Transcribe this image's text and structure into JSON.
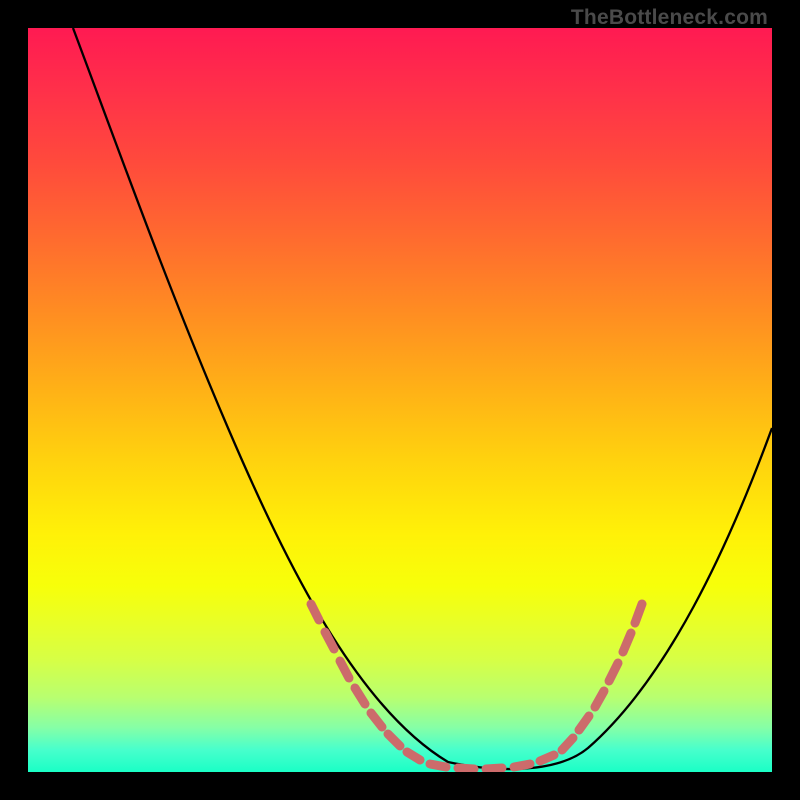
{
  "watermark": {
    "text": "TheBottleneck.com"
  },
  "chart_data": {
    "type": "line",
    "title": "",
    "xlabel": "",
    "ylabel": "",
    "xlim": [
      0,
      100
    ],
    "ylim": [
      0,
      100
    ],
    "grid": false,
    "legend": false,
    "series": [
      {
        "name": "bottleneck-curve",
        "color": "#000000",
        "x": [
          6,
          10,
          14,
          18,
          22,
          26,
          30,
          34,
          38,
          42,
          46,
          50,
          54,
          58,
          62,
          66,
          70,
          74,
          78,
          82,
          86,
          90,
          94,
          98,
          100
        ],
        "y": [
          100,
          92,
          84,
          76,
          68,
          60,
          52,
          44,
          37,
          30,
          23,
          16,
          10,
          5,
          2,
          0,
          0,
          1,
          4,
          9,
          16,
          25,
          35,
          46,
          52
        ]
      }
    ],
    "markers": {
      "name": "dashed-sample-points",
      "color": "#cc6b6b",
      "shape": "rounded-rect",
      "points_left": [
        [
          38,
          23
        ],
        [
          39,
          21
        ],
        [
          41,
          18
        ],
        [
          43,
          15
        ],
        [
          45,
          12
        ],
        [
          46.5,
          10
        ],
        [
          48,
          8
        ],
        [
          50,
          6
        ],
        [
          52,
          4.5
        ],
        [
          54,
          3
        ],
        [
          56,
          2
        ]
      ],
      "points_floor": [
        [
          57,
          1
        ],
        [
          60,
          0.3
        ],
        [
          63,
          0
        ],
        [
          66,
          0
        ],
        [
          69,
          0.3
        ],
        [
          72,
          1
        ]
      ],
      "points_right": [
        [
          74,
          2
        ],
        [
          75.5,
          4
        ],
        [
          77,
          6
        ],
        [
          78.5,
          9
        ],
        [
          80,
          12
        ],
        [
          81,
          14
        ],
        [
          82,
          17
        ],
        [
          83.5,
          21
        ],
        [
          85,
          25
        ]
      ]
    },
    "background": {
      "type": "vertical-gradient",
      "description": "red (high bottleneck) at top to green (low bottleneck) at bottom"
    }
  }
}
